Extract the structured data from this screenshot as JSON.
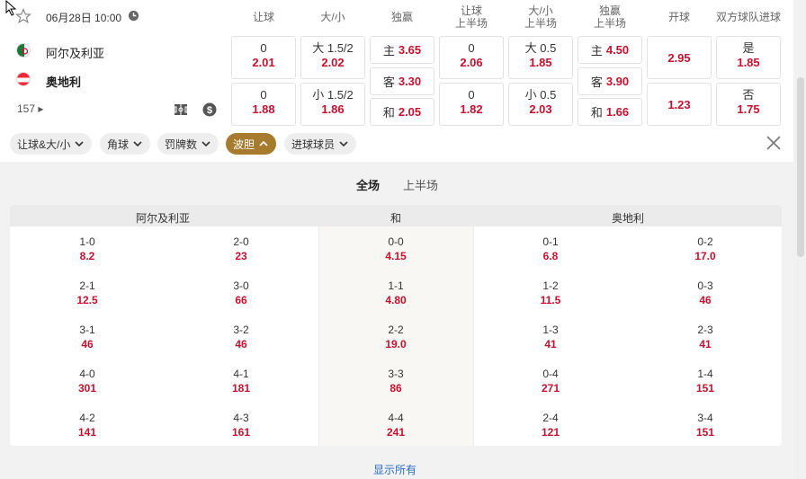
{
  "match": {
    "date": "06月28日 10:00",
    "home": "阿尔及利亚",
    "away": "奥地利",
    "more_markets": "157"
  },
  "headers": [
    "让球",
    "大/小",
    "独赢",
    "让球\n上半场",
    "大/小\n上半场",
    "独赢\n上半场",
    "开球",
    "双方球队进球"
  ],
  "odds": {
    "hdp_home": {
      "line": "0",
      "odds": "2.01"
    },
    "hdp_away": {
      "line": "0",
      "odds": "1.88"
    },
    "ou_over": {
      "line": "大 1.5/2",
      "odds": "2.02"
    },
    "ou_under": {
      "line": "小 1.5/2",
      "odds": "1.86"
    },
    "x12_home": {
      "label": "主",
      "odds": "3.65"
    },
    "x12_away": {
      "label": "客",
      "odds": "3.30"
    },
    "x12_draw": {
      "label": "和",
      "odds": "2.05"
    },
    "hdp1h_home": {
      "line": "0",
      "odds": "2.06"
    },
    "hdp1h_away": {
      "line": "0",
      "odds": "1.82"
    },
    "ou1h_over": {
      "line": "大 0.5",
      "odds": "1.85"
    },
    "ou1h_under": {
      "line": "小 0.5",
      "odds": "2.03"
    },
    "x121h_home": {
      "label": "主",
      "odds": "4.50"
    },
    "x121h_away": {
      "label": "客",
      "odds": "3.90"
    },
    "x121h_draw": {
      "label": "和",
      "odds": "1.66"
    },
    "kick_home": "2.95",
    "kick_away": "1.23",
    "btts_yes": {
      "label": "是",
      "odds": "1.85"
    },
    "btts_no": {
      "label": "否",
      "odds": "1.75"
    }
  },
  "chips": [
    {
      "label": "让球&大/小"
    },
    {
      "label": "角球"
    },
    {
      "label": "罚牌数"
    },
    {
      "label": "波胆"
    },
    {
      "label": "进球球员"
    }
  ],
  "tabs": [
    "全场",
    "上半场"
  ],
  "grid": {
    "home_header": "阿尔及利亚",
    "draw_header": "和",
    "away_header": "奥地利",
    "rows": [
      [
        [
          "1-0",
          "8.2"
        ],
        [
          "2-0",
          "23"
        ],
        [
          "0-0",
          "4.15"
        ],
        [
          "0-1",
          "6.8"
        ],
        [
          "0-2",
          "17.0"
        ]
      ],
      [
        [
          "2-1",
          "12.5"
        ],
        [
          "3-0",
          "66"
        ],
        [
          "1-1",
          "4.80"
        ],
        [
          "1-2",
          "11.5"
        ],
        [
          "0-3",
          "46"
        ]
      ],
      [
        [
          "3-1",
          "46"
        ],
        [
          "3-2",
          "46"
        ],
        [
          "2-2",
          "19.0"
        ],
        [
          "1-3",
          "41"
        ],
        [
          "2-3",
          "41"
        ]
      ],
      [
        [
          "4-0",
          "301"
        ],
        [
          "4-1",
          "181"
        ],
        [
          "3-3",
          "86"
        ],
        [
          "0-4",
          "271"
        ],
        [
          "1-4",
          "151"
        ]
      ],
      [
        [
          "4-2",
          "141"
        ],
        [
          "4-3",
          "161"
        ],
        [
          "4-4",
          "241"
        ],
        [
          "2-4",
          "121"
        ],
        [
          "3-4",
          "151"
        ]
      ]
    ]
  },
  "show_all": "显示所有",
  "colors": {
    "odds": "#c8102e",
    "active_chip": "#a67b2e",
    "link": "#2a6dc5"
  }
}
